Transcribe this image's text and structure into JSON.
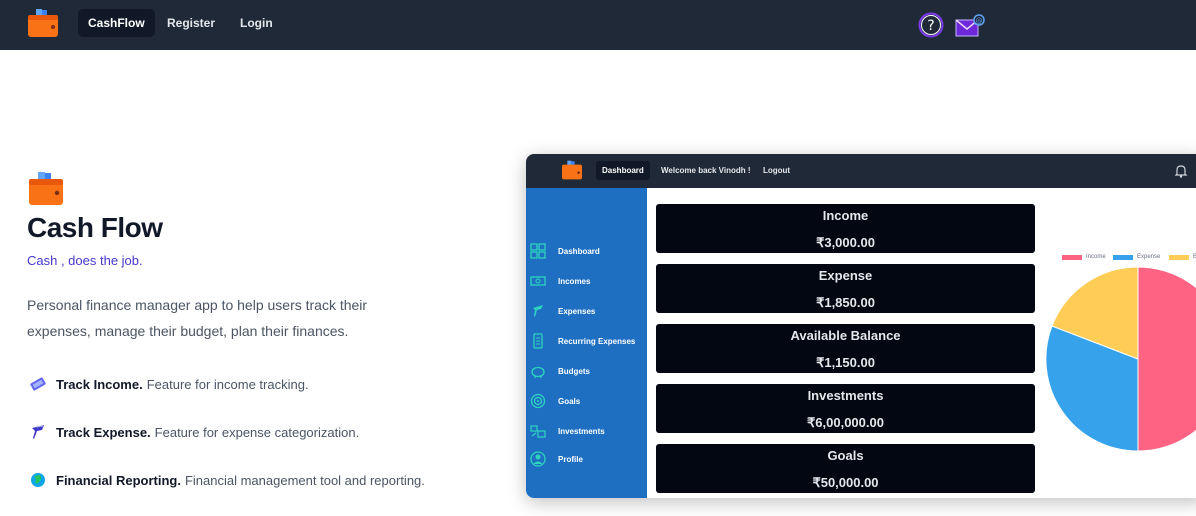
{
  "nav": {
    "items": [
      {
        "label": "CashFlow",
        "active": true
      },
      {
        "label": "Register",
        "active": false
      },
      {
        "label": "Login",
        "active": false
      }
    ],
    "icons": [
      "wallet-icon",
      "question-icon",
      "mail-icon"
    ]
  },
  "hero": {
    "title": "Cash Flow",
    "tagline": "Cash , does the job.",
    "description": "Personal finance manager app to help users track their expenses, manage their budget, plan their finances."
  },
  "features": [
    {
      "title": "Track Income.",
      "text": "Feature for income tracking.",
      "icon": "money-icon"
    },
    {
      "title": "Track Expense.",
      "text": "Feature for expense categorization.",
      "icon": "expense-icon"
    },
    {
      "title": "Financial Reporting.",
      "text": "Financial management tool and reporting.",
      "icon": "globe-icon"
    }
  ],
  "preview": {
    "nav": [
      {
        "label": "Dashboard",
        "active": true
      },
      {
        "label": "Welcome back Vinodh !",
        "active": false
      },
      {
        "label": "Logout",
        "active": false
      }
    ],
    "sidebar": [
      {
        "label": "Dashboard",
        "icon": "grid-icon"
      },
      {
        "label": "Incomes",
        "icon": "cash-icon"
      },
      {
        "label": "Expenses",
        "icon": "expense-icon"
      },
      {
        "label": "Recurring Expenses",
        "icon": "recurring-icon"
      },
      {
        "label": "Budgets",
        "icon": "piggy-bank-icon"
      },
      {
        "label": "Goals",
        "icon": "target-icon"
      },
      {
        "label": "Investments",
        "icon": "investment-icon"
      },
      {
        "label": "Profile",
        "icon": "profile-icon"
      }
    ],
    "cards": [
      {
        "title": "Income",
        "value": "₹3,000.00"
      },
      {
        "title": "Expense",
        "value": "₹1,850.00"
      },
      {
        "title": "Available Balance",
        "value": "₹1,150.00"
      },
      {
        "title": "Investments",
        "value": "₹6,00,000.00"
      },
      {
        "title": "Goals",
        "value": "₹50,000.00"
      }
    ],
    "legend": [
      {
        "label": "Income",
        "color": "#ff6384"
      },
      {
        "label": "Expense",
        "color": "#36a2eb"
      },
      {
        "label": "B",
        "color": "#ffcd56"
      }
    ],
    "colors": {
      "topbar": "#1f2937",
      "sidebar": "#1e6fc2",
      "card": "#030712"
    }
  }
}
